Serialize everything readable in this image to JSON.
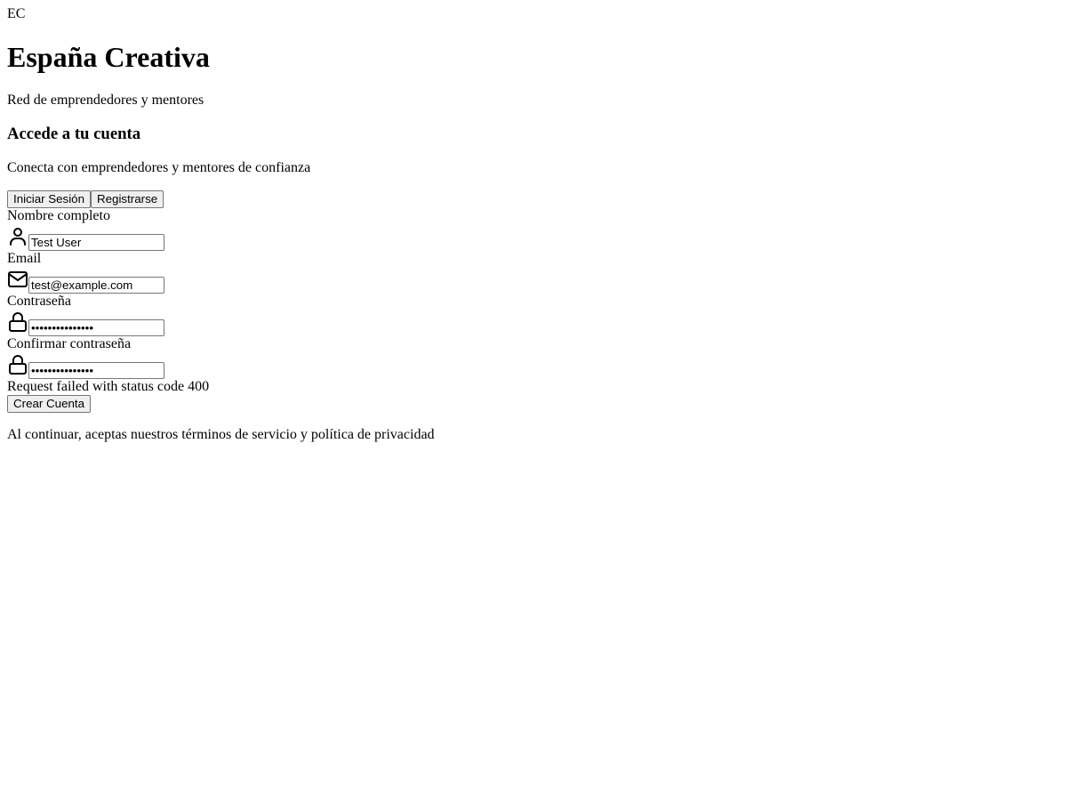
{
  "brand": {
    "logo_text": "EC",
    "title": "España Creativa",
    "subtitle": "Red de emprendedores y mentores"
  },
  "auth": {
    "heading": "Accede a tu cuenta",
    "description": "Conecta con emprendedores y mentores de confianza",
    "tabs": {
      "login": "Iniciar Sesión",
      "register": "Registrarse"
    },
    "fields": {
      "name": {
        "label": "Nombre completo",
        "value": "Test User",
        "icon": "user-icon"
      },
      "email": {
        "label": "Email",
        "value": "test@example.com",
        "icon": "mail-icon"
      },
      "password": {
        "label": "Contraseña",
        "value": "password1234567",
        "icon": "lock-icon"
      },
      "confirm_password": {
        "label": "Confirmar contraseña",
        "value": "password1234567",
        "icon": "lock-icon"
      }
    },
    "error": "Request failed with status code 400",
    "submit_label": "Crear Cuenta",
    "terms": "Al continuar, aceptas nuestros términos de servicio y política de privacidad"
  }
}
